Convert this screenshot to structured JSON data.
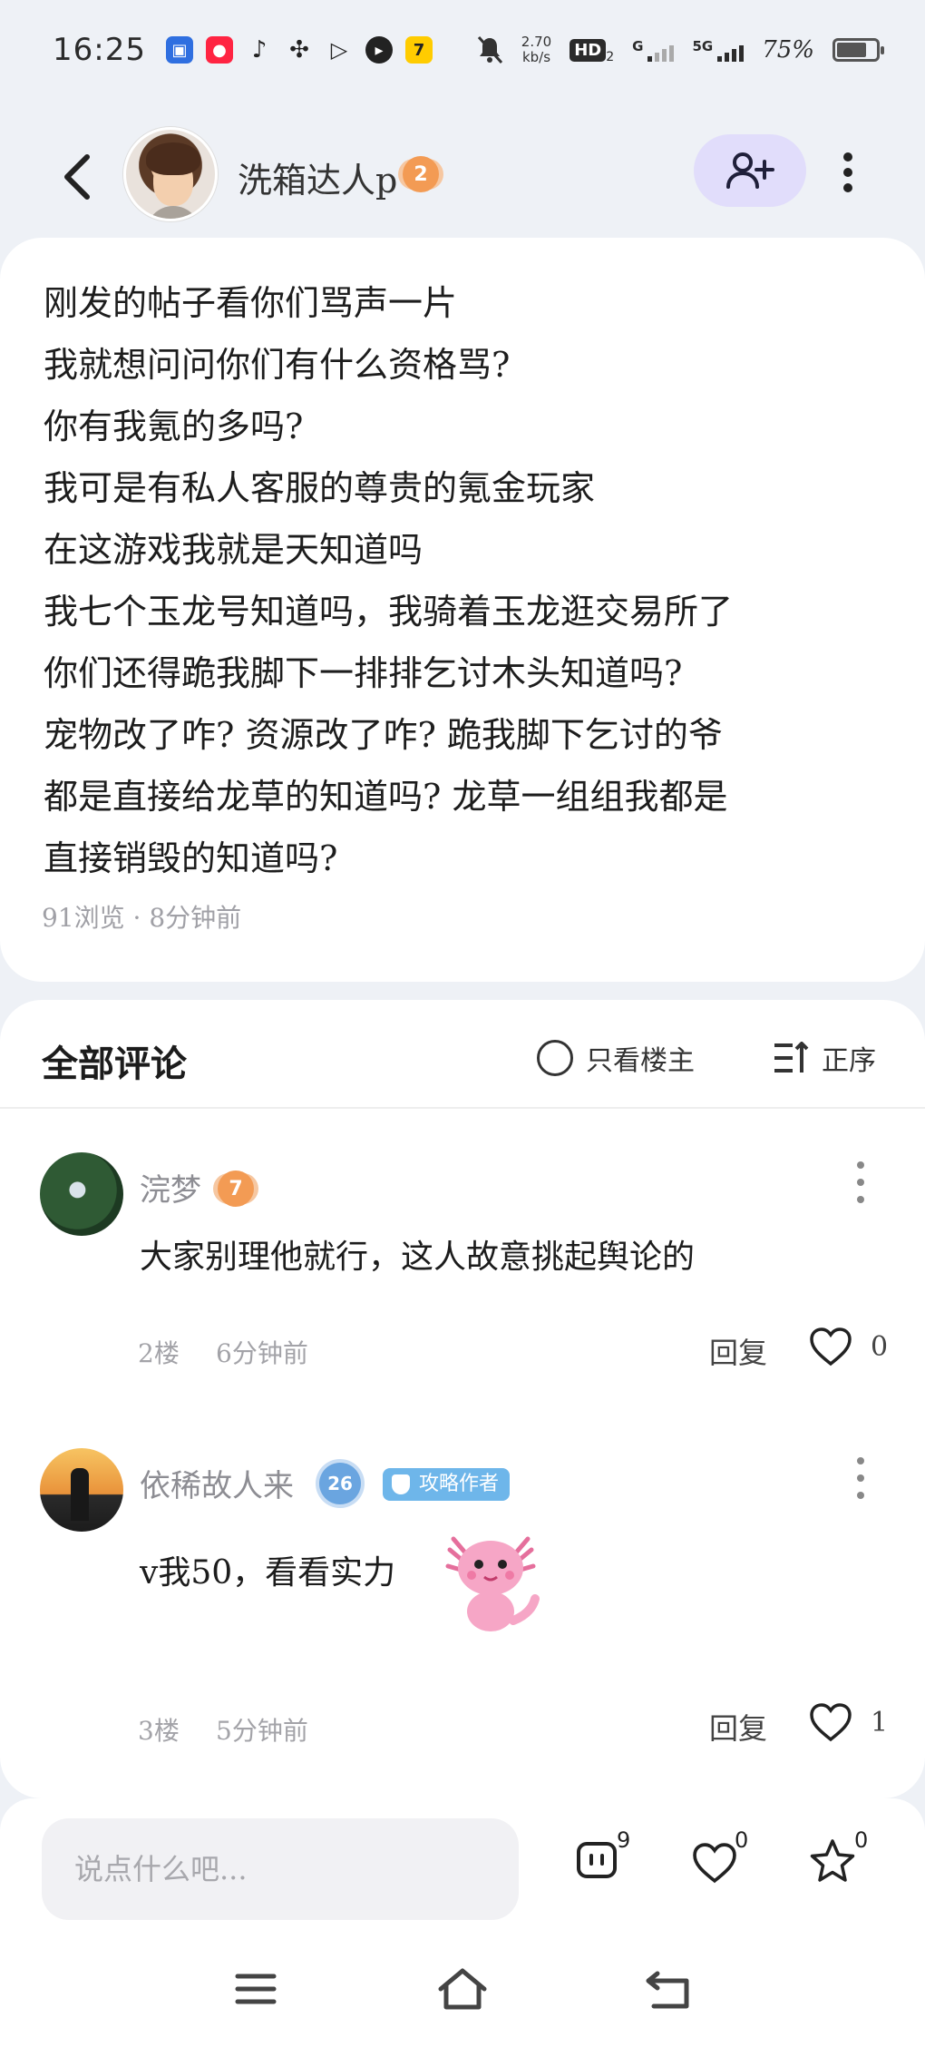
{
  "status_bar": {
    "time": "16:25",
    "net_speed_value": "2.70",
    "net_speed_unit": "kb/s",
    "hd_label": "HD",
    "hd_sub": "2",
    "signal1_label": "G",
    "signal2_label": "5G",
    "battery": "75%",
    "battery_level": 0.75
  },
  "header": {
    "username": "洗箱达人p",
    "level": "2"
  },
  "post": {
    "lines": [
      "刚发的帖子看你们骂声一片",
      "我就想问问你们有什么资格骂?",
      "你有我氪的多吗?",
      "我可是有私人客服的尊贵的氪金玩家",
      "在这游戏我就是天知道吗",
      "我七个玉龙号知道吗，我骑着玉龙逛交易所了",
      "你们还得跪我脚下一排排乞讨木头知道吗?",
      "宠物改了咋? 资源改了咋? 跪我脚下乞讨的爷",
      "都是直接给龙草的知道吗? 龙草一组组我都是",
      "直接销毁的知道吗?"
    ],
    "meta": "91浏览 · 8分钟前"
  },
  "comments_section": {
    "title": "全部评论",
    "op_only_label": "只看楼主",
    "sort_label": "正序"
  },
  "comments": [
    {
      "name": "浣梦",
      "level": "7",
      "text": "大家别理他就行，这人故意挑起舆论的",
      "floor": "2楼",
      "time": "6分钟前",
      "reply_label": "回复",
      "likes": "0"
    },
    {
      "name": "依稀故人来",
      "level": "26",
      "tag": "攻略作者",
      "text": "v我50，看看实力",
      "floor": "3楼",
      "time": "5分钟前",
      "reply_label": "回复",
      "likes": "1"
    }
  ],
  "bottom_bar": {
    "input_placeholder": "说点什么吧...",
    "comment_count": "9",
    "like_count": "0",
    "favorite_count": "0"
  },
  "colors": {
    "accent_purple": "#e1ddfb",
    "level_orange": "#f39b54",
    "level_blue": "#6aa5e0",
    "tag_blue": "#6eb6ea"
  }
}
